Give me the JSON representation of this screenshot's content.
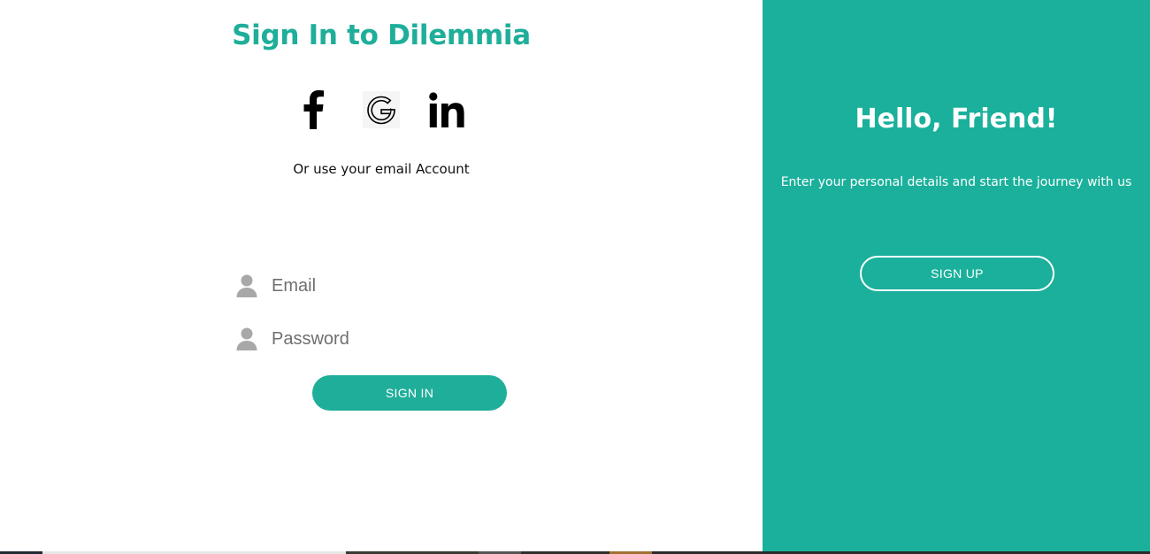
{
  "left": {
    "title": "Sign In to Dilemmia",
    "social": [
      {
        "name": "facebook",
        "icon": "facebook-icon"
      },
      {
        "name": "google",
        "icon": "google-icon"
      },
      {
        "name": "linkedin",
        "icon": "linkedin-icon"
      }
    ],
    "alt_text": "Or use your email Account",
    "email": {
      "placeholder": "Email",
      "value": "",
      "icon": "user-icon"
    },
    "password": {
      "placeholder": "Password",
      "value": "",
      "icon": "user-icon"
    },
    "signin_label": "SIGN IN"
  },
  "right": {
    "heading": "Hello, Friend!",
    "tagline": "Enter your personal details and start the journey with us",
    "signup_label": "SIGN UP"
  },
  "colors": {
    "accent": "#1fae9a",
    "right_panel": "#1ab09b",
    "icon_gray": "#a8a8a8",
    "text_dark": "#111111"
  }
}
